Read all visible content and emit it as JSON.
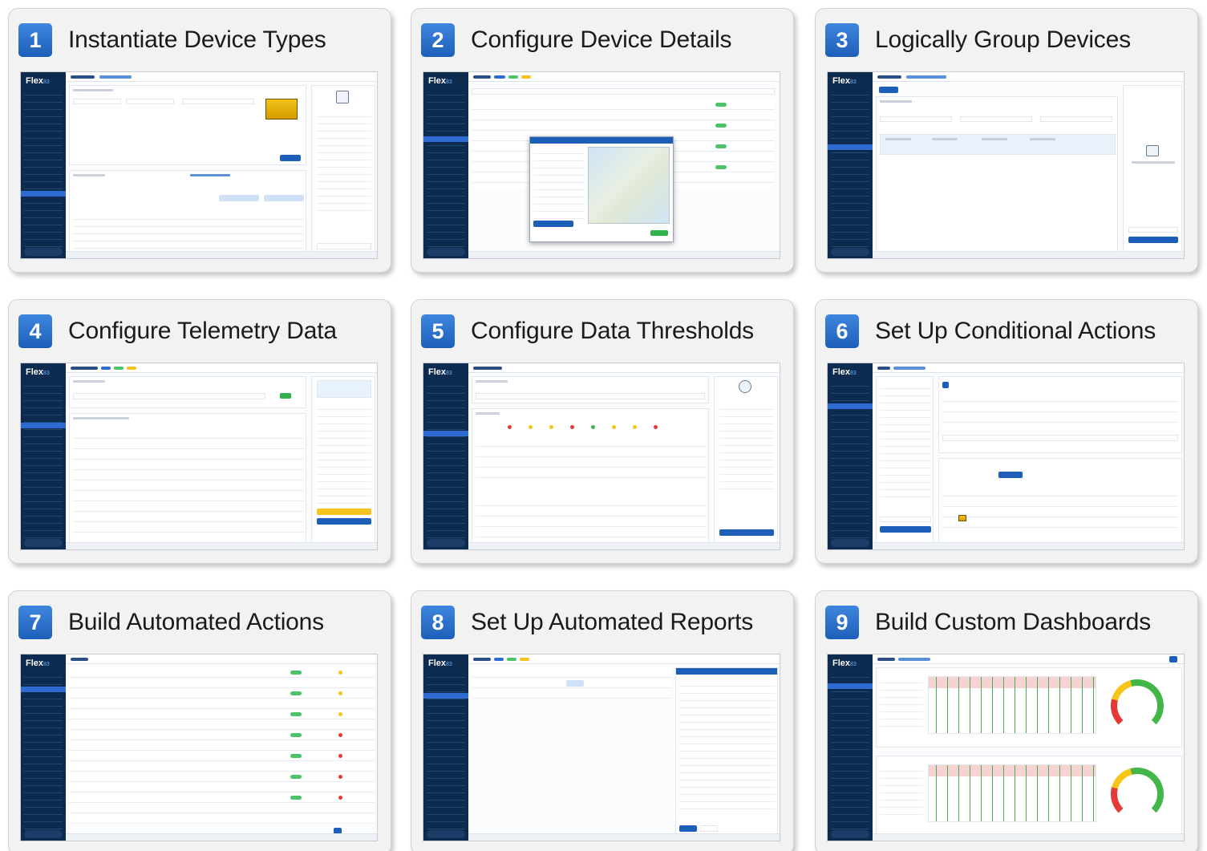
{
  "app": {
    "logo_main": "Flex",
    "logo_sub": "83"
  },
  "steps": [
    {
      "number": "1",
      "title": "Instantiate Device Types"
    },
    {
      "number": "2",
      "title": "Configure Device Details"
    },
    {
      "number": "3",
      "title": "Logically Group Devices"
    },
    {
      "number": "4",
      "title": "Configure Telemetry Data"
    },
    {
      "number": "5",
      "title": "Configure Data Thresholds"
    },
    {
      "number": "6",
      "title": "Set Up Conditional Actions"
    },
    {
      "number": "7",
      "title": "Build Automated Actions"
    },
    {
      "number": "8",
      "title": "Set Up Automated Reports"
    },
    {
      "number": "9",
      "title": "Build Custom Dashboards"
    }
  ],
  "colors": {
    "badge": "#1d5fb8",
    "sidebar": "#0d2a4f",
    "accent_green": "#2fb34a",
    "accent_yellow": "#f6c21c"
  }
}
